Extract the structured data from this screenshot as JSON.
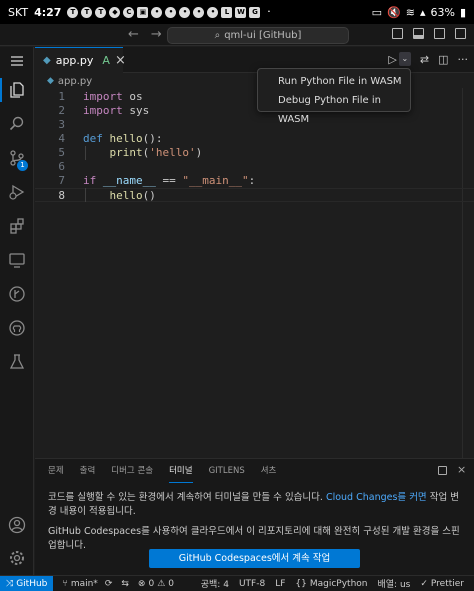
{
  "android": {
    "time": "4:27",
    "carrier": "SKT",
    "battery": "63%",
    "notif_icons": [
      "talk-icon",
      "talk-icon",
      "talk-icon",
      "shield-icon",
      "c-icon",
      "gallery-icon",
      "app-icon",
      "app-icon",
      "app-icon",
      "app-icon",
      "app-icon",
      "lf-icon",
      "w-icon",
      "g-icon"
    ]
  },
  "titlebar": {
    "command_center": "qml-ui [GitHub]"
  },
  "tab": {
    "label": "app.py",
    "status": "A"
  },
  "breadcrumb": {
    "file": "app.py"
  },
  "code": {
    "lines": [
      {
        "num": "1",
        "tokens": [
          [
            "kw",
            "import"
          ],
          [
            "plain",
            " os"
          ]
        ]
      },
      {
        "num": "2",
        "tokens": [
          [
            "kw",
            "import"
          ],
          [
            "plain",
            " sys"
          ]
        ]
      },
      {
        "num": "3",
        "tokens": []
      },
      {
        "num": "4",
        "tokens": [
          [
            "kwd",
            "def"
          ],
          [
            "plain",
            " "
          ],
          [
            "fn",
            "hello"
          ],
          [
            "plain",
            "():"
          ]
        ]
      },
      {
        "num": "5",
        "tokens": [
          [
            "plain",
            "    "
          ],
          [
            "fn",
            "print"
          ],
          [
            "plain",
            "("
          ],
          [
            "str",
            "'hello'"
          ],
          [
            "plain",
            ")"
          ]
        ]
      },
      {
        "num": "6",
        "tokens": []
      },
      {
        "num": "7",
        "tokens": [
          [
            "kw",
            "if"
          ],
          [
            "plain",
            " "
          ],
          [
            "var",
            "__name__"
          ],
          [
            "plain",
            " == "
          ],
          [
            "str",
            "\"__main__\""
          ],
          [
            "plain",
            ":"
          ]
        ]
      },
      {
        "num": "8",
        "tokens": [
          [
            "plain",
            "    "
          ],
          [
            "fn",
            "hello"
          ],
          [
            "plain",
            "()"
          ]
        ]
      }
    ],
    "active_line": "8"
  },
  "run_menu": {
    "items": [
      "Run Python File in WASM",
      "Debug Python File in WASM"
    ]
  },
  "panel": {
    "tabs": [
      "문제",
      "출력",
      "디버그 콘솔",
      "터미널",
      "GITLENS",
      "셔츠"
    ],
    "active_tab": "터미널",
    "message1_a": "코드를 실행할 수 있는 환경에서 계속하여 터미널을 만들 수 있습니다.",
    "message1_link": "Cloud Changes를 커면",
    "message1_b": "작업 변경 내용이 적용됩니다.",
    "message2": "GitHub Codespaces를 사용하여 클라우드에서 이 리포지토리에 대해 완전히 구성된 개발 환경을 스핀업합니다.",
    "button": "GitHub Codespaces에서 계속 작업"
  },
  "statusbar": {
    "remote": "GitHub",
    "branch": "main*",
    "errors": "0",
    "warnings": "0",
    "spaces": "공백: 4",
    "encoding": "UTF-8",
    "eol": "LF",
    "language": "MagicPython",
    "layout": "배열: us",
    "prettier": "Prettier"
  },
  "colors": {
    "accent": "#0078d4",
    "keyword": "#c586c0",
    "string": "#ce9178",
    "function": "#dcdcaa"
  }
}
